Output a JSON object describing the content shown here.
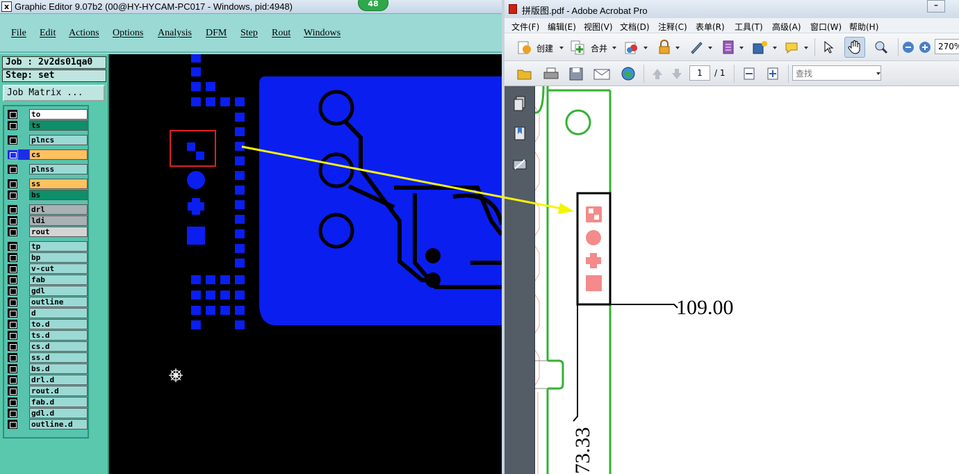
{
  "graphic_editor": {
    "window_title": "Graphic Editor 9.07b2 (00@HY-HYCAM-PC017 - Windows, pid:4948)",
    "app_icon": "x",
    "badge_count": "48",
    "menu": [
      "File",
      "Edit",
      "Actions",
      "Options",
      "Analysis",
      "DFM",
      "Step",
      "Rout",
      "Windows"
    ],
    "job_label": "Job : 2v2ds01qa0",
    "step_label": "Step: set",
    "job_matrix_button": "Job Matrix ...",
    "layers": [
      {
        "name": "to",
        "color": "#ffffff"
      },
      {
        "name": "ts",
        "color": "#0e8f6a"
      },
      {
        "name": "plncs",
        "color": "#9ad9d4"
      },
      {
        "name": "cs",
        "color": "#ffc060",
        "active": true
      },
      {
        "name": "plnss",
        "color": "#9ad9d4"
      },
      {
        "name": "ss",
        "color": "#ffc060"
      },
      {
        "name": "bs",
        "color": "#0e8f6a"
      },
      {
        "name": "drl",
        "color": "#a9b1b4"
      },
      {
        "name": "ldi",
        "color": "#a9b1b4"
      },
      {
        "name": "rout",
        "color": "#d4d4d4"
      },
      {
        "name": "tp",
        "color": "#9ad9d4"
      },
      {
        "name": "bp",
        "color": "#9ad9d4"
      },
      {
        "name": "v-cut",
        "color": "#9ad9d4"
      },
      {
        "name": "fab",
        "color": "#9ad9d4"
      },
      {
        "name": "gdl",
        "color": "#9ad9d4"
      },
      {
        "name": "outline",
        "color": "#9ad9d4"
      },
      {
        "name": "d",
        "color": "#9ad9d4"
      },
      {
        "name": "to.d",
        "color": "#9ad9d4"
      },
      {
        "name": "ts.d",
        "color": "#9ad9d4"
      },
      {
        "name": "cs.d",
        "color": "#9ad9d4"
      },
      {
        "name": "ss.d",
        "color": "#9ad9d4"
      },
      {
        "name": "bs.d",
        "color": "#9ad9d4"
      },
      {
        "name": "drl.d",
        "color": "#9ad9d4"
      },
      {
        "name": "rout.d",
        "color": "#9ad9d4"
      },
      {
        "name": "fab.d",
        "color": "#9ad9d4"
      },
      {
        "name": "gdl.d",
        "color": "#9ad9d4"
      },
      {
        "name": "outline.d",
        "color": "#9ad9d4"
      }
    ],
    "colors": {
      "feature": "#0a1ef0",
      "highlight_box": "#e02020",
      "arrow": "#f5f500"
    }
  },
  "acrobat": {
    "window_title": "拼版图.pdf - Adobe Acrobat Pro",
    "minimize_glyph": "–",
    "menu": [
      "文件(F)",
      "编辑(E)",
      "视图(V)",
      "文档(D)",
      "注释(C)",
      "表单(R)",
      "工具(T)",
      "高级(A)",
      "窗口(W)",
      "帮助(H)"
    ],
    "toolbar": {
      "create_label": "创建",
      "combine_label": "合并",
      "zoom_value": "270%",
      "page_current": "1",
      "page_total": "/ 1",
      "find_placeholder": "查找"
    },
    "drawing": {
      "dimension_1": "109.00",
      "dimension_2": "73.33"
    },
    "colors": {
      "outline": "#33b233",
      "pad": "#f58a8a",
      "frame": "#000000"
    }
  }
}
